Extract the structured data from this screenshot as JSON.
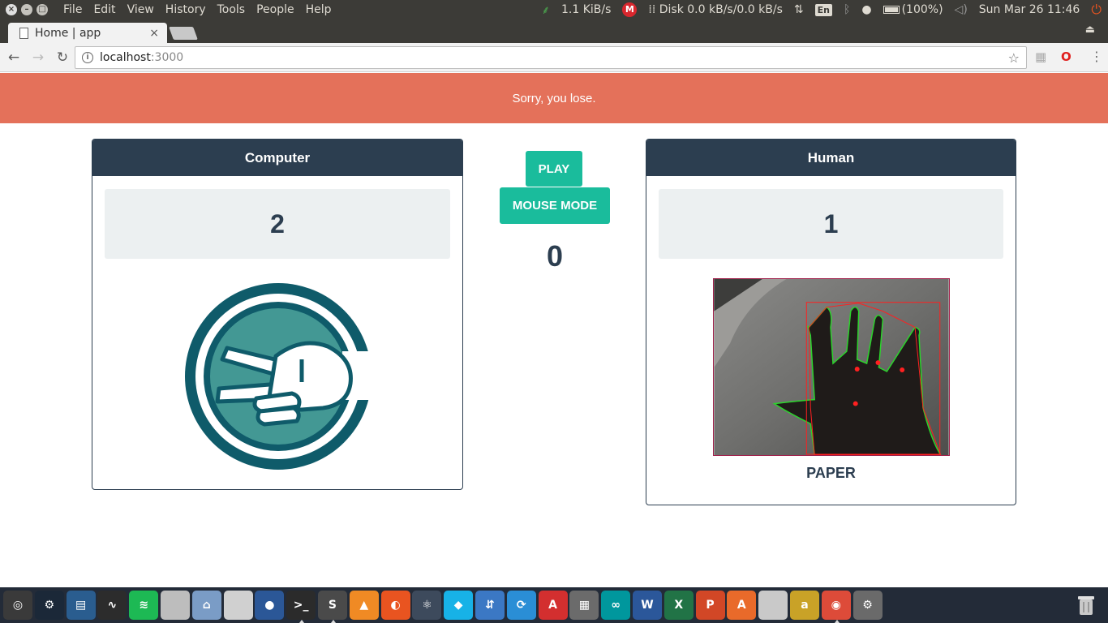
{
  "top_panel": {
    "menu": [
      "File",
      "Edit",
      "View",
      "History",
      "Tools",
      "People",
      "Help"
    ],
    "net_speed": "1.1 KiB/s",
    "disk": "Disk 0.0 kB/s/0.0 kB/s",
    "keyboard": "En",
    "battery": "(100%)",
    "clock": "Sun Mar 26 11:46"
  },
  "browser": {
    "tab_title": "Home | app",
    "tab_close": "×",
    "url_host": "localhost",
    "url_port": ":3000"
  },
  "game": {
    "result_message": "Sorry, you lose.",
    "computer": {
      "title": "Computer",
      "score": "2",
      "move_icon": "scissors-hand-icon"
    },
    "human": {
      "title": "Human",
      "score": "1",
      "gesture": "PAPER"
    },
    "controls": {
      "play_label": "PLAY",
      "mouse_mode_label": "MOUSE MODE",
      "ties": "0"
    }
  },
  "launcher": {
    "apps": [
      {
        "name": "dash-icon",
        "color": "#3a3a3a",
        "glyph": "◎"
      },
      {
        "name": "steam-icon",
        "color": "#1b2838",
        "glyph": "⚙"
      },
      {
        "name": "terminal-window-icon",
        "color": "#2a5d8f",
        "glyph": "▤"
      },
      {
        "name": "system-monitor-icon",
        "color": "#2c2c2c",
        "glyph": "∿"
      },
      {
        "name": "spotify-icon",
        "color": "#1db954",
        "glyph": "≋"
      },
      {
        "name": "files-icon",
        "color": "#bdbdbd",
        "glyph": ""
      },
      {
        "name": "home-folder-icon",
        "color": "#7a9cc6",
        "glyph": "⌂"
      },
      {
        "name": "text-editor-icon",
        "color": "#d0d0d0",
        "glyph": ""
      },
      {
        "name": "firefox-icon",
        "color": "#2b5797",
        "glyph": "●"
      },
      {
        "name": "terminal-icon",
        "color": "#2b2b2b",
        "glyph": ">_"
      },
      {
        "name": "sublime-icon",
        "color": "#4a4a4a",
        "glyph": "S"
      },
      {
        "name": "vlc-icon",
        "color": "#f08a24",
        "glyph": "▲"
      },
      {
        "name": "ubuntu-software-icon",
        "color": "#e95420",
        "glyph": "◐"
      },
      {
        "name": "atom-icon",
        "color": "#3d4a5c",
        "glyph": "⚛"
      },
      {
        "name": "kodi-icon",
        "color": "#17b2e7",
        "glyph": "◆"
      },
      {
        "name": "network-icon",
        "color": "#3b78c4",
        "glyph": "⇵"
      },
      {
        "name": "sync-icon",
        "color": "#2a8ed6",
        "glyph": "⟳"
      },
      {
        "name": "pdf-icon",
        "color": "#d32f2f",
        "glyph": "A"
      },
      {
        "name": "calculator-icon",
        "color": "#6b6b6b",
        "glyph": "▦"
      },
      {
        "name": "arduino-icon",
        "color": "#00979d",
        "glyph": "∞"
      },
      {
        "name": "word-icon",
        "color": "#2b579a",
        "glyph": "W"
      },
      {
        "name": "excel-icon",
        "color": "#217346",
        "glyph": "X"
      },
      {
        "name": "powerpoint-icon",
        "color": "#d24726",
        "glyph": "P"
      },
      {
        "name": "app-center-icon",
        "color": "#e96a2a",
        "glyph": "A"
      },
      {
        "name": "blank-app-icon",
        "color": "#c9c9c9",
        "glyph": ""
      },
      {
        "name": "amazon-icon",
        "color": "#c9a227",
        "glyph": "a"
      },
      {
        "name": "chrome-icon",
        "color": "#dd4b39",
        "glyph": "◉"
      },
      {
        "name": "settings-icon",
        "color": "#6a6a6a",
        "glyph": "⚙"
      }
    ]
  },
  "colors": {
    "banner": "#e4715a",
    "panel_header": "#2c3e50",
    "button": "#1abc9c",
    "computer_icon": "#0f5b6a",
    "computer_icon_fill": "#439894"
  }
}
